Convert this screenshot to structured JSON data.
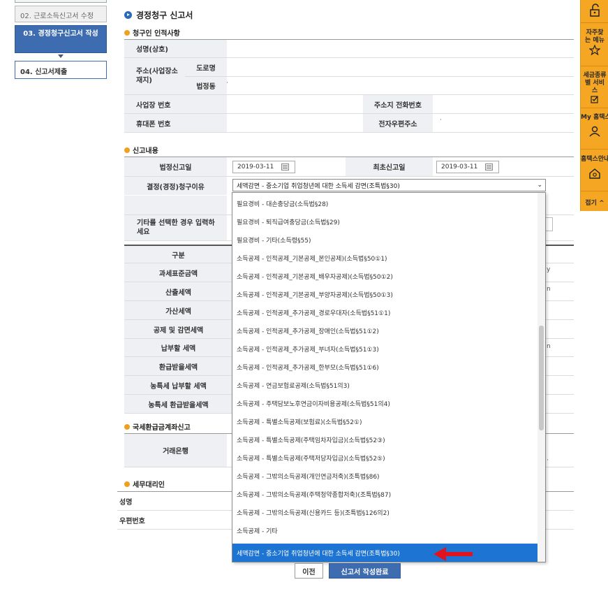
{
  "steps": {
    "step02": "02. 근로소득신고서 수정",
    "step03": "03. 경정청구신고서 작성",
    "step04": "04. 신고서제출"
  },
  "quick_menu": {
    "faq": "자주찾는 메뉴",
    "tax_service": "세금종류별 서비스",
    "my_hometax": "My 홈택스",
    "hometax_app": "홈택스안내",
    "close": "접기 ^"
  },
  "title": "경정청구 신고서",
  "claimant": {
    "section": "청구인 인적사항",
    "name_label": "성명(상호)",
    "address_label": "주소(사업장소재지)",
    "road_label": "도로명",
    "lot_label": "법정동",
    "biz_no_label": "사업장 번호",
    "phone_label": "주소지 전화번호",
    "mobile_label": "휴대폰 번호",
    "email_label": "전자우편주소"
  },
  "report": {
    "section": "신고내용",
    "legal_date_label": "법정신고일",
    "legal_date": "2019-03-11",
    "first_date_label": "최초신고일",
    "first_date": "2019-03-11",
    "reason_label": "결정(경정)청구이유",
    "reason_selected": "세액감면 - 중소기업 취업청년에 대한 소득세 감면(조특법§30)",
    "other_label": "기타를 선택한 경우 입력하세요"
  },
  "calc_table": {
    "header": "구분",
    "rows": [
      "과세표준금액",
      "산출세액",
      "가산세액",
      "공제 및 감면세액",
      "납부할 세액",
      "환급받을세액",
      "농특세 납부할 세액",
      "농특세 환급받을세액"
    ]
  },
  "refund": {
    "section": "국세환급금계좌신고",
    "bank_label": "거래은행"
  },
  "agent": {
    "section": "세무대리인",
    "name_label": "성명",
    "zip_label": "우편번호"
  },
  "dropdown_options": [
    "필요경비 - 대손충당금(소득법§28)",
    "필요경비 - 퇴직급여충당금(소득법§29)",
    "필요경비 - 기타(소득령§55)",
    "소득공제 - 인적공제_기본공제_본인공제)(소득법§50①1)",
    "소득공제 - 인적공제_기본공제_배우자공제)(소득법§50①2)",
    "소득공제 - 인적공제_기본공제_부양자공제)(소득법§50①3)",
    "소득공제 - 인적공제_추가공제_경로우대자(소득법§51①1)",
    "소득공제 - 인적공제_추가공제_장애인(소득법§51①2)",
    "소득공제 - 인적공제_추가공제_부녀자(소득법§51①3)",
    "소득공제 - 인적공제_추가공제_한부모(소득법§51①6)",
    "소득공제 - 연금보험료공제(소득법§51의3)",
    "소득공제 - 주택담보노후연금이자비용공제(소득법§51의4)",
    "소득공제 - 특별소득공제(보험료)(소득법§52①)",
    "소득공제 - 특별소득공제(주택임차자입금)(소득법§52③)",
    "소득공제 - 특별소득공제(주택저당자입금)(소득법§52⑤)",
    "소득공제 - 그밖의소득공제(개인연금저축)(조특법§86)",
    "소득공제 - 그밖의소득공제(주택청약종합저축)(조특법§87)",
    "소득공제 - 그밖의소득공제(신용카드 등)(조특법§126의2)",
    "소득공제 - 기타",
    "세액감면 - 중소기업 취업청년에 대한 소득세 감면(조특법§30)"
  ],
  "buttons": {
    "prev": "이전",
    "done": "신고서 작성완료"
  },
  "colors": {
    "accent_blue": "#3d6cb0",
    "selected_option": "#1e74d3",
    "quick_menu_orange": "#f5a623",
    "arrow_red": "#e0141e"
  }
}
